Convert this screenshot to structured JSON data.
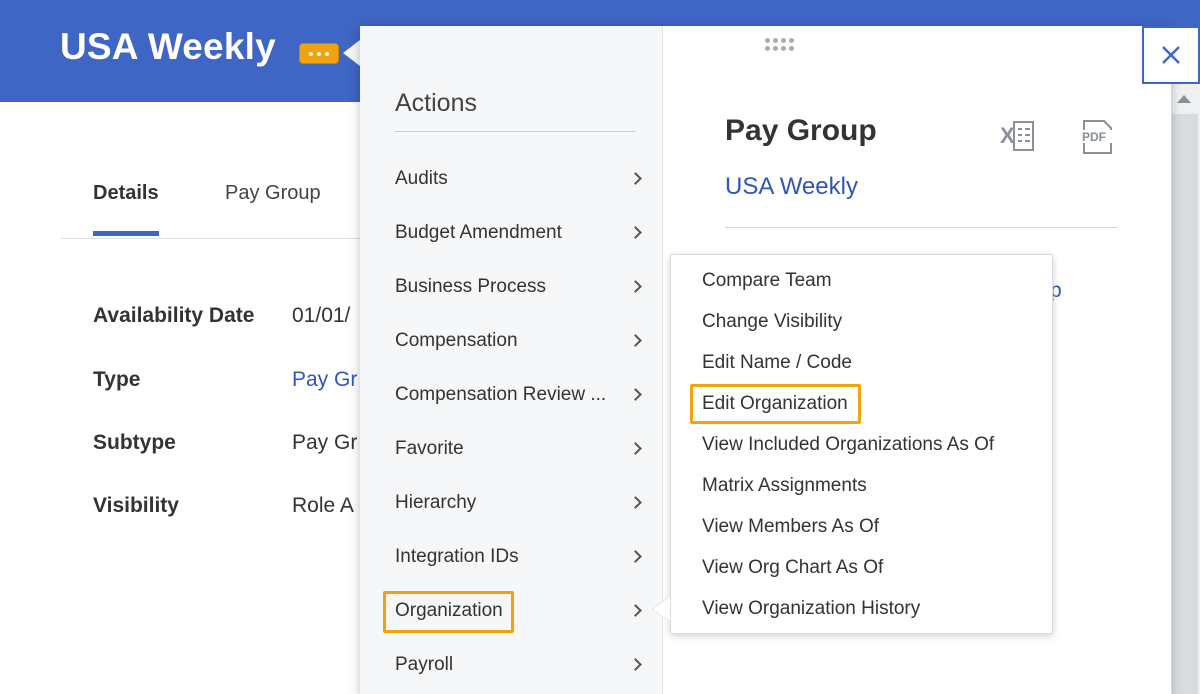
{
  "header": {
    "title": "USA Weekly",
    "related_actions_icon": "ellipsis-icon",
    "color": "#3f65c5"
  },
  "tabs": [
    {
      "label": "Details",
      "active": true
    },
    {
      "label": "Pay Group",
      "active": false
    }
  ],
  "fields": [
    {
      "label": "Availability Date",
      "value": "01/01/"
    },
    {
      "label": "Type",
      "value": "Pay Gr"
    },
    {
      "label": "Subtype",
      "value": "Pay Gr"
    },
    {
      "label": "Visibility",
      "value": "Role A"
    }
  ],
  "actions_panel": {
    "heading": "Actions",
    "items": [
      {
        "label": "Audits"
      },
      {
        "label": "Budget Amendment"
      },
      {
        "label": "Business Process"
      },
      {
        "label": "Compensation"
      },
      {
        "label": "Compensation Review ..."
      },
      {
        "label": "Favorite"
      },
      {
        "label": "Hierarchy"
      },
      {
        "label": "Integration IDs"
      },
      {
        "label": "Organization",
        "highlighted": true
      },
      {
        "label": "Payroll"
      }
    ]
  },
  "detail_panel": {
    "title": "Pay Group",
    "link": "USA Weekly",
    "partial_link": "p",
    "export_icons": [
      "excel-icon",
      "pdf-icon"
    ]
  },
  "submenu": {
    "items": [
      {
        "label": "Compare Team"
      },
      {
        "label": "Change Visibility"
      },
      {
        "label": "Edit Name / Code"
      },
      {
        "label": "Edit Organization",
        "highlighted": true
      },
      {
        "label": "View Included Organizations As Of"
      },
      {
        "label": "Matrix Assignments"
      },
      {
        "label": "View Members As Of"
      },
      {
        "label": "View Org Chart As Of"
      },
      {
        "label": "View Organization History"
      }
    ]
  },
  "highlight_color": "#f0a30a",
  "link_color": "#2f57b8"
}
